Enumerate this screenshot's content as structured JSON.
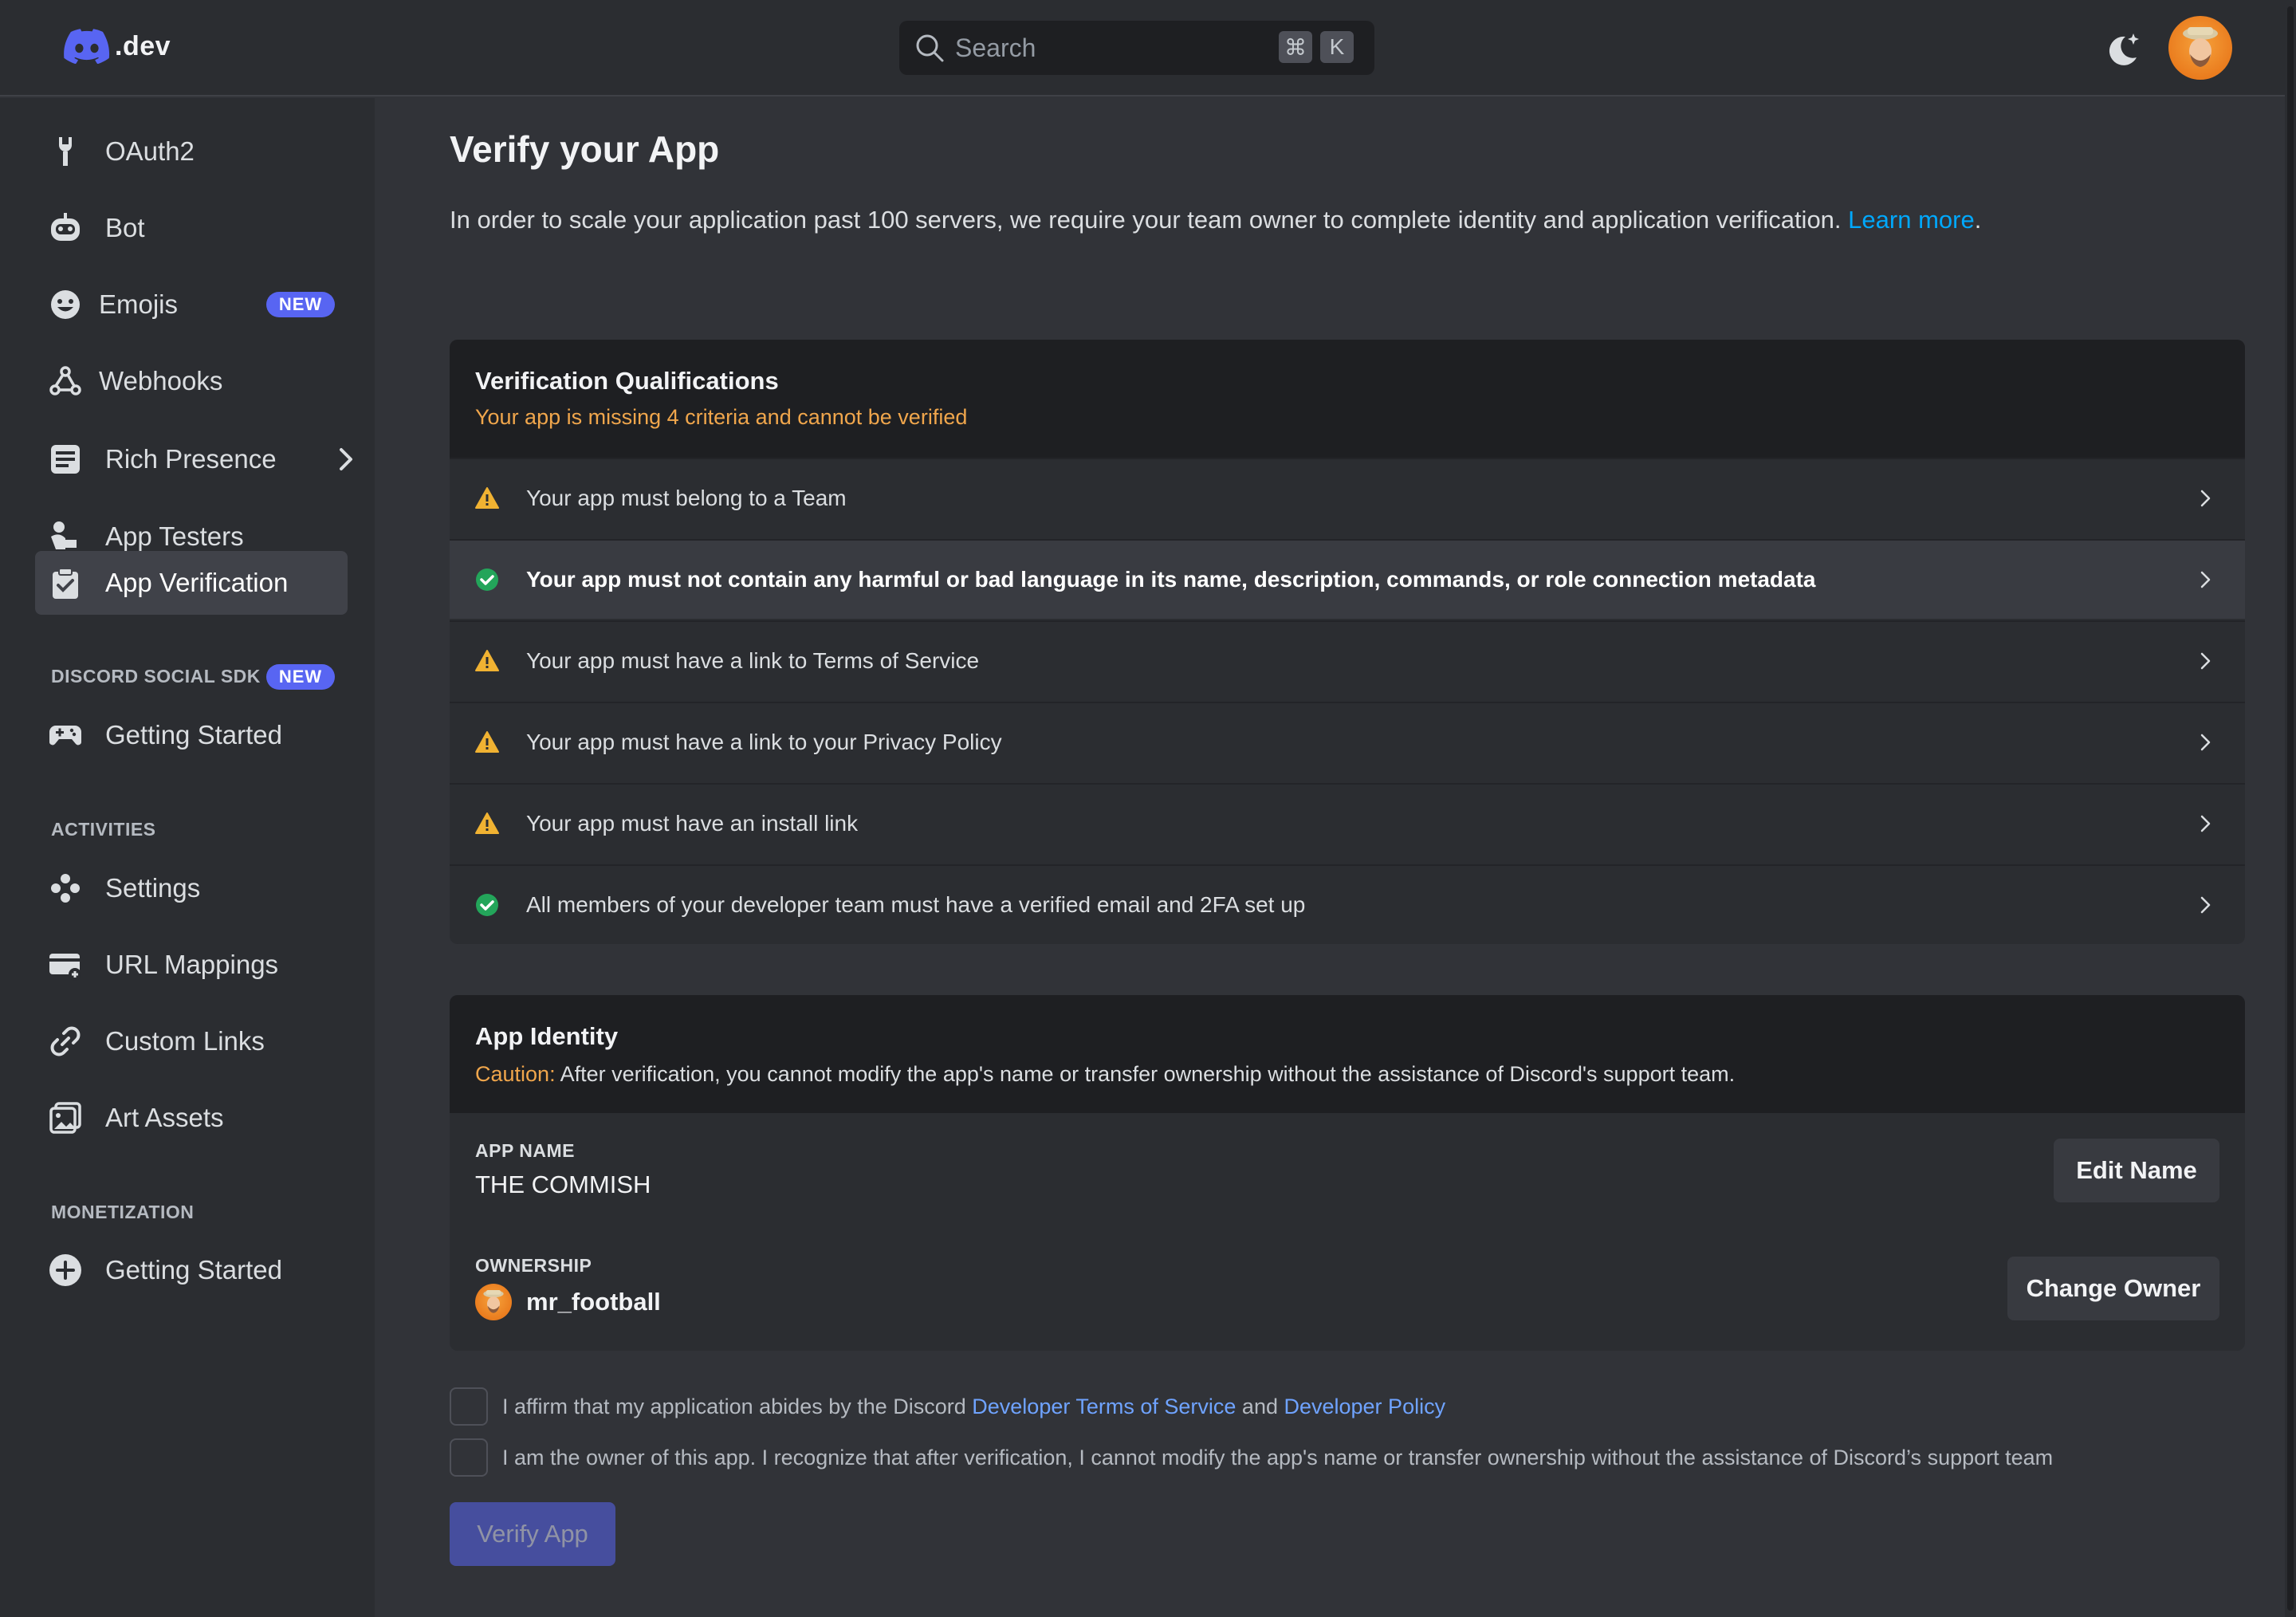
{
  "header": {
    "logo_text": ".dev",
    "search_placeholder": "Search",
    "kbd_cmd": "⌘",
    "kbd_k": "K"
  },
  "sidebar": {
    "items": [
      {
        "label": "OAuth2",
        "icon": "wrench-icon"
      },
      {
        "label": "Bot",
        "icon": "bot-icon"
      },
      {
        "label": "Emojis",
        "icon": "emoji-icon",
        "badge": "NEW"
      },
      {
        "label": "Webhooks",
        "icon": "webhook-icon"
      },
      {
        "label": "Rich Presence",
        "icon": "document-icon"
      },
      {
        "label": "App Testers",
        "icon": "testers-icon"
      },
      {
        "label": "App Verification",
        "icon": "clipboard-check-icon",
        "active": true
      }
    ],
    "social_sdk": {
      "title": "DISCORD SOCIAL SDK",
      "badge": "NEW",
      "items": [
        {
          "label": "Getting Started",
          "icon": "gamepad-icon"
        }
      ]
    },
    "activities": {
      "title": "ACTIVITIES",
      "items": [
        {
          "label": "Settings",
          "icon": "activity-settings-icon"
        },
        {
          "label": "URL Mappings",
          "icon": "url-mapping-icon"
        },
        {
          "label": "Custom Links",
          "icon": "link-icon"
        },
        {
          "label": "Art Assets",
          "icon": "image-icon"
        }
      ]
    },
    "monetization": {
      "title": "MONETIZATION",
      "items": [
        {
          "label": "Getting Started",
          "icon": "plus-circle-icon"
        }
      ]
    }
  },
  "main": {
    "title": "Verify your App",
    "subtitle": "In order to scale your application past 100 servers, we require your team owner to complete identity and application verification.",
    "learn_more": "Learn more",
    "period": ".",
    "qualifications": {
      "title": "Verification Qualifications",
      "status": "Your app is missing 4 criteria and cannot be verified",
      "criteria": [
        {
          "text": "Your app must belong to a Team",
          "met": false
        },
        {
          "text": "Your app must not contain any harmful or bad language in its name, description, commands, or role connection metadata",
          "met": true
        },
        {
          "text": "Your app must have a link to Terms of Service",
          "met": false
        },
        {
          "text": "Your app must have a link to your Privacy Policy",
          "met": false
        },
        {
          "text": "Your app must have an install link",
          "met": false
        },
        {
          "text": "All members of your developer team must have a verified email and 2FA set up",
          "met": true
        }
      ]
    },
    "identity": {
      "title": "App Identity",
      "caution_label": "Caution:",
      "caution_text": " After verification, you cannot modify the app's name or transfer ownership without the assistance of Discord's support team.",
      "app_name_label": "APP NAME",
      "app_name": "THE COMMISH",
      "edit_name": "Edit Name",
      "ownership_label": "OWNERSHIP",
      "owner": "mr_football",
      "change_owner": "Change Owner"
    },
    "affirm": {
      "text1": "I affirm that my application abides by the Discord ",
      "link1": "Developer Terms of Service",
      "and": " and ",
      "link2": "Developer Policy",
      "text2": "I am the owner of this app. I recognize that after verification, I cannot modify the app's name or transfer ownership without the assistance of Discord’s support team"
    },
    "verify_button": "Verify App"
  },
  "colors": {
    "accent": "#5865f2",
    "warning": "#f0b232",
    "success": "#23a55a",
    "link": "#00a8fc"
  }
}
